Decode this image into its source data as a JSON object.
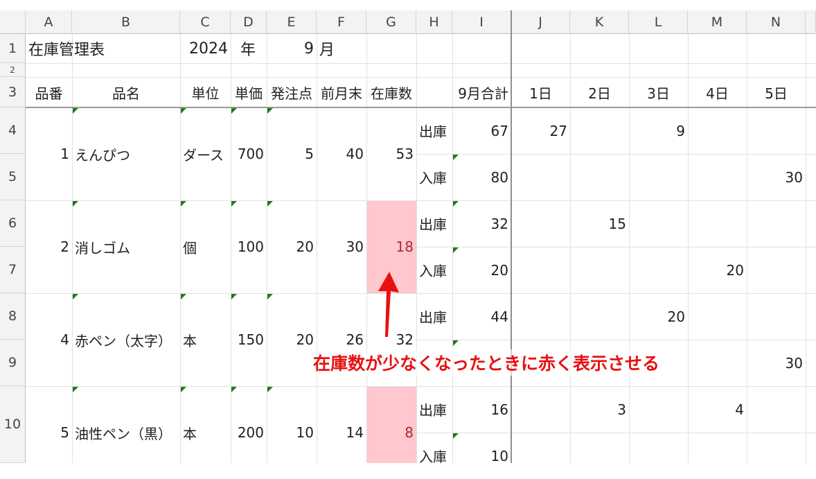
{
  "columns": [
    "A",
    "B",
    "C",
    "D",
    "E",
    "F",
    "G",
    "H",
    "I",
    "J",
    "K",
    "L",
    "M",
    "N"
  ],
  "rows": [
    "1",
    "2",
    "3",
    "4",
    "5",
    "6",
    "7",
    "8",
    "9",
    "10"
  ],
  "title": {
    "label": "在庫管理表",
    "year": "2024",
    "year_unit": "年",
    "month": "9",
    "month_unit": "月"
  },
  "headers": {
    "code": "品番",
    "name": "品名",
    "unit": "単位",
    "price": "単価",
    "reorder": "発注点",
    "prev_end": "前月末",
    "stock": "在庫数",
    "month_total": "9月合計",
    "day1": "1日",
    "day2": "2日",
    "day3": "3日",
    "day4": "4日",
    "day5": "5日"
  },
  "items": [
    {
      "code": "1",
      "name": "えんぴつ",
      "unit": "ダース",
      "price": "700",
      "reorder": "5",
      "prev_end": "40",
      "stock": "53",
      "out_label": "出庫",
      "out_total": "67",
      "in_label": "入庫",
      "in_total": "80",
      "out_d1": "27",
      "out_d3": "9",
      "in_d5": "30"
    },
    {
      "code": "2",
      "name": "消しゴム",
      "unit": "個",
      "price": "100",
      "reorder": "20",
      "prev_end": "30",
      "stock": "18",
      "out_label": "出庫",
      "out_total": "32",
      "in_label": "入庫",
      "in_total": "20",
      "out_d2": "15",
      "in_d4": "20"
    },
    {
      "code": "4",
      "name": "赤ペン（太字）",
      "unit": "本",
      "price": "150",
      "reorder": "20",
      "prev_end": "26",
      "stock": "32",
      "out_label": "出庫",
      "out_total": "44",
      "out_d3": "20",
      "in_d5": "30"
    },
    {
      "code": "5",
      "name": "油性ペン（黒）",
      "unit": "本",
      "price": "200",
      "reorder": "10",
      "prev_end": "14",
      "stock": "8",
      "out_label": "出庫",
      "out_total": "16",
      "in_label": "入庫",
      "in_total": "10",
      "out_d2": "3",
      "out_d4": "4"
    }
  ],
  "annotation": {
    "text": "在庫数が少なくなったときに赤く表示させる",
    "color": "#e81010"
  },
  "colors": {
    "highlight_fill": "#ffc7ce",
    "highlight_text": "#b02a2a",
    "comment_marker": "#1e7b1e"
  }
}
